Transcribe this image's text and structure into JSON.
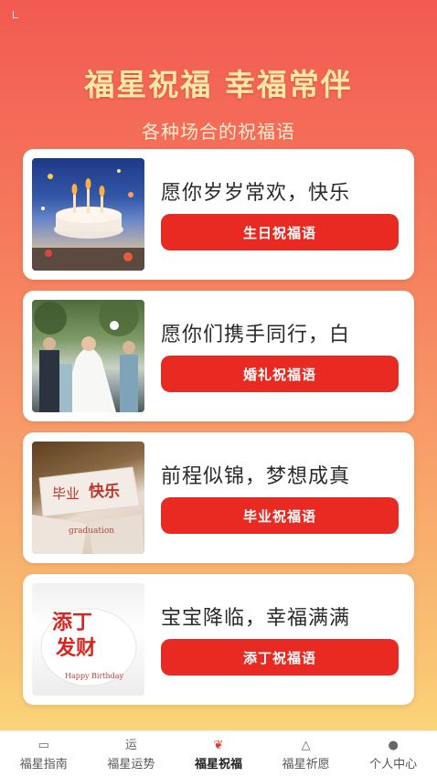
{
  "hero": {
    "title": "福星祝福 幸福常伴",
    "subtitle": "各种场合的祝福语"
  },
  "cards": [
    {
      "text": "愿你岁岁常欢，快乐",
      "button": "生日祝福语",
      "image": "birthday-cake-painting"
    },
    {
      "text": "愿你们携手同行，白",
      "button": "婚礼祝福语",
      "image": "wedding-photo"
    },
    {
      "text": "前程似锦，梦想成真",
      "button": "毕业祝福语",
      "image": "graduation-cards",
      "image_text": [
        "毕业",
        "快乐",
        "graduation"
      ]
    },
    {
      "text": "宝宝降临，幸福满满",
      "button": "添丁祝福语",
      "image": "baby-cake",
      "image_text": [
        "添丁",
        "发财",
        "Happy Birthday"
      ]
    }
  ],
  "nav": {
    "items": [
      {
        "label": "福星指南",
        "icon": "book-icon",
        "glyph": "▭"
      },
      {
        "label": "福星运势",
        "icon": "fortune-icon",
        "glyph": "运"
      },
      {
        "label": "福星祝福",
        "icon": "blessing-icon",
        "glyph": "❦",
        "active": true
      },
      {
        "label": "福星祈愿",
        "icon": "wish-icon",
        "glyph": "△"
      },
      {
        "label": "个人中心",
        "icon": "chat-icon",
        "glyph": "●"
      }
    ]
  },
  "colors": {
    "accent": "#e82a22",
    "title": "#fde9a6"
  }
}
